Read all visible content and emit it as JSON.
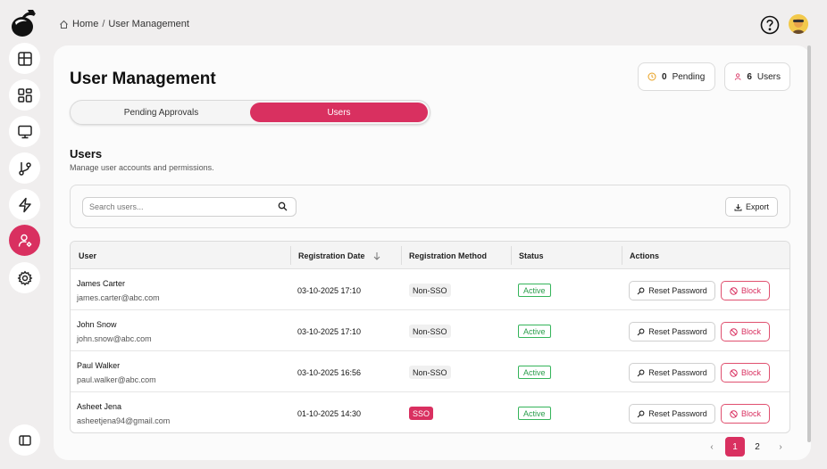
{
  "breadcrumb": {
    "home": "Home",
    "separator": "/",
    "current": "User Management"
  },
  "sidebar": {
    "items": [
      {
        "icon": "table-icon"
      },
      {
        "icon": "grid-icon"
      },
      {
        "icon": "monitor-icon"
      },
      {
        "icon": "git-branch-icon"
      },
      {
        "icon": "lightning-icon"
      },
      {
        "icon": "user-settings-icon",
        "active": true
      },
      {
        "icon": "gear-icon"
      }
    ]
  },
  "header": {
    "title": "User Management"
  },
  "stats": {
    "pending": {
      "count": "0",
      "label": "Pending"
    },
    "users": {
      "count": "6",
      "label": "Users"
    }
  },
  "tabs": [
    {
      "label": "Pending Approvals",
      "active": false
    },
    {
      "label": "Users",
      "active": true
    }
  ],
  "section": {
    "title": "Users",
    "subtitle": "Manage user accounts and permissions."
  },
  "search": {
    "placeholder": "Search users..."
  },
  "export_label": "Export",
  "table": {
    "headers": [
      "User",
      "Registration Date",
      "Registration Method",
      "Status",
      "Actions"
    ],
    "rows": [
      {
        "name": "James Carter",
        "email": "james.carter@abc.com",
        "date": "03-10-2025 17:10",
        "method": "Non-SSO",
        "status": "Active"
      },
      {
        "name": "John Snow",
        "email": "john.snow@abc.com",
        "date": "03-10-2025 17:10",
        "method": "Non-SSO",
        "status": "Active"
      },
      {
        "name": "Paul Walker",
        "email": "paul.walker@abc.com",
        "date": "03-10-2025 16:56",
        "method": "Non-SSO",
        "status": "Active"
      },
      {
        "name": "Asheet Jena",
        "email": "asheetjena94@gmail.com",
        "date": "01-10-2025 14:30",
        "method": "SSO",
        "status": "Active"
      }
    ],
    "actions": {
      "reset": "Reset Password",
      "block": "Block"
    }
  },
  "pagination": {
    "prev": "‹",
    "pages": [
      "1",
      "2"
    ],
    "current": "1",
    "next": "›"
  },
  "colors": {
    "accent": "#d93060",
    "active_status": "#35b45a"
  }
}
